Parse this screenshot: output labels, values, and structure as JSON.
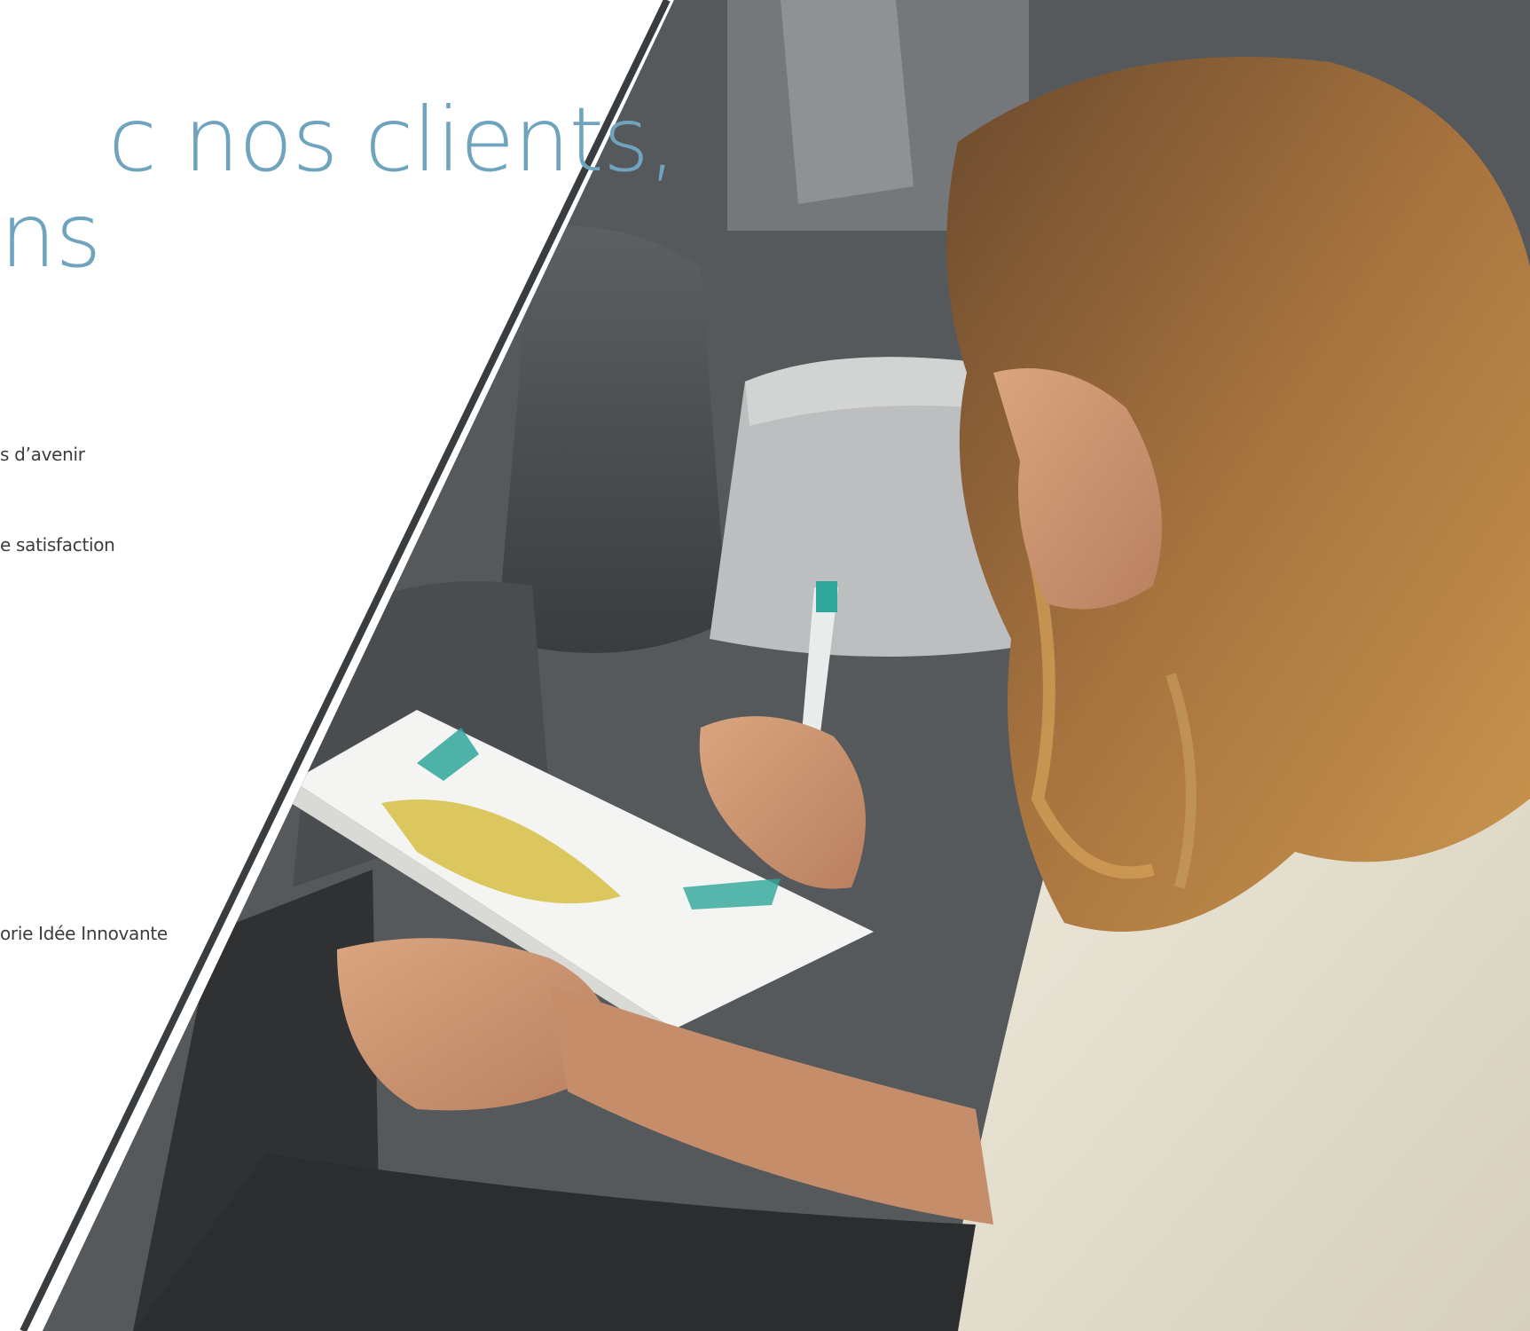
{
  "headline": {
    "line_1": "c nos clients,",
    "line_2": "ns"
  },
  "items": [
    {
      "text": "s d’avenir"
    },
    {
      "text": "e satisfaction"
    },
    {
      "text": "orie Idée Innovante"
    }
  ],
  "colors": {
    "headline": "#6ea4bd",
    "body_text": "#3c3c3c",
    "divider": "#3a3d40",
    "background": "#ffffff"
  },
  "photo": {
    "icon": "girl-drawing-on-train-photo"
  }
}
